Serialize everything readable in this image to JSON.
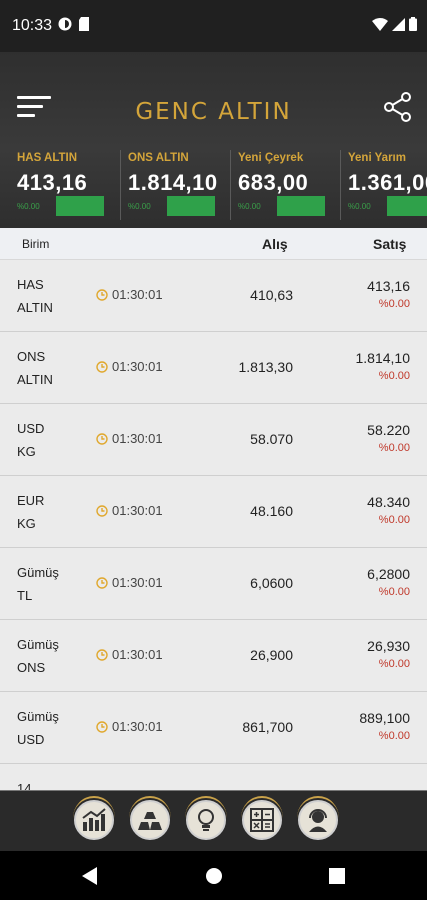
{
  "status_bar": {
    "time": "10:33"
  },
  "header": {
    "brand": "GENC ALTIN"
  },
  "tickers": [
    {
      "name": "HAS ALTIN",
      "value": "413,16",
      "change": "%0.00"
    },
    {
      "name": "ONS ALTIN",
      "value": "1.814,10",
      "change": "%0.00"
    },
    {
      "name": "Yeni Çeyrek",
      "value": "683,00",
      "change": "%0.00"
    },
    {
      "name": "Yeni Yarım",
      "value": "1.361,00",
      "change": "%0.00"
    }
  ],
  "table": {
    "col_birim": "Birim",
    "col_alis": "Alış",
    "col_satis": "Satış"
  },
  "rows": [
    {
      "name": "HAS\nALTIN",
      "time": "01:30:01",
      "alis": "410,63",
      "satis": "413,16",
      "pct": "%0.00"
    },
    {
      "name": "ONS\nALTIN",
      "time": "01:30:01",
      "alis": "1.813,30",
      "satis": "1.814,10",
      "pct": "%0.00"
    },
    {
      "name": "USD\nKG",
      "time": "01:30:01",
      "alis": "58.070",
      "satis": "58.220",
      "pct": "%0.00"
    },
    {
      "name": "EUR\nKG",
      "time": "01:30:01",
      "alis": "48.160",
      "satis": "48.340",
      "pct": "%0.00"
    },
    {
      "name": "Gümüş\nTL",
      "time": "01:30:01",
      "alis": "6,0600",
      "satis": "6,2800",
      "pct": "%0.00"
    },
    {
      "name": "Gümüş\nONS",
      "time": "01:30:01",
      "alis": "26,900",
      "satis": "26,930",
      "pct": "%0.00"
    },
    {
      "name": "Gümüş\nUSD",
      "time": "01:30:01",
      "alis": "861,700",
      "satis": "889,100",
      "pct": "%0.00"
    },
    {
      "name": "14",
      "time": "",
      "alis": "",
      "satis": "",
      "pct": ""
    }
  ],
  "bottom_nav": [
    {
      "icon": "chart-icon"
    },
    {
      "icon": "gold-bars-icon"
    },
    {
      "icon": "idea-icon"
    },
    {
      "icon": "calculator-icon"
    },
    {
      "icon": "support-icon"
    }
  ],
  "colors": {
    "gold": "#d4a53a",
    "green": "#2fa14a",
    "red": "#c0392b"
  }
}
